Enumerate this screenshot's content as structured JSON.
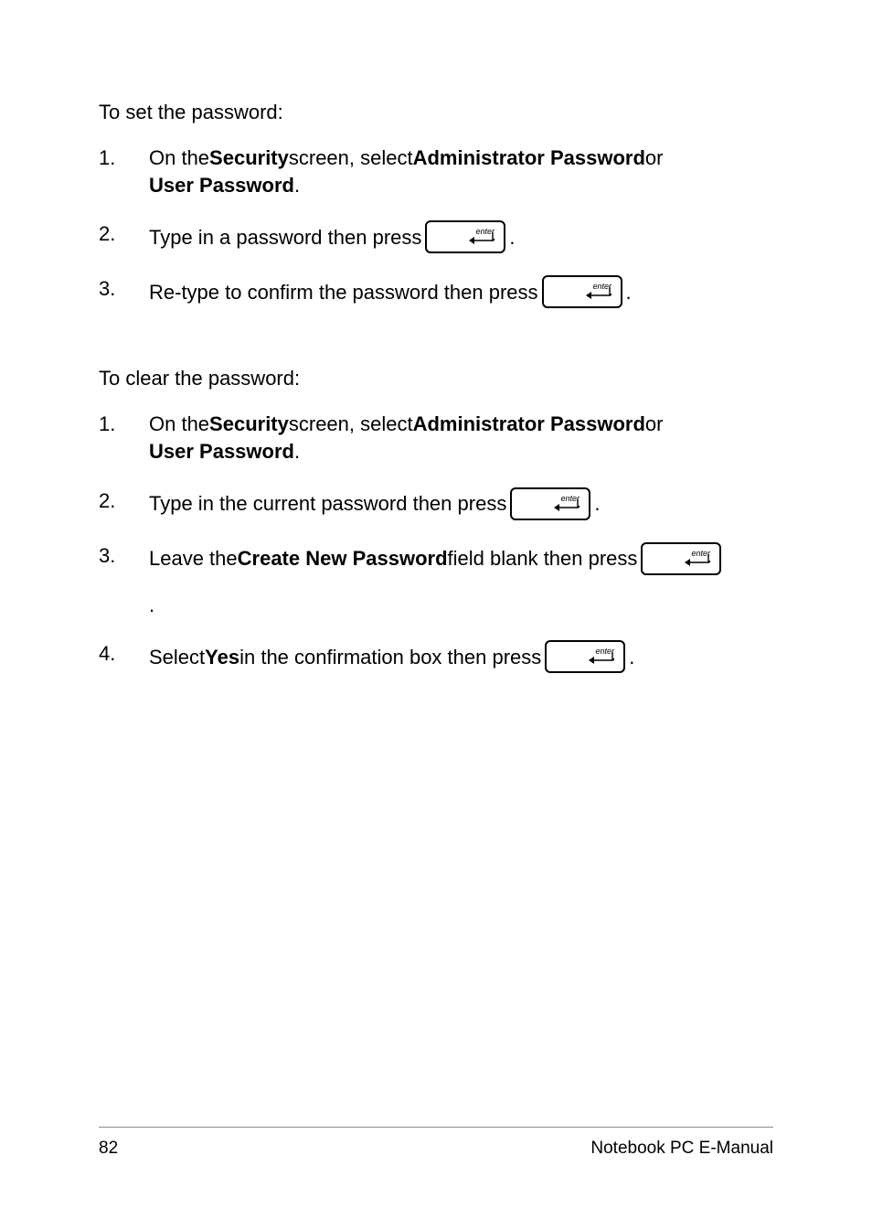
{
  "set": {
    "intro": "To set the password:",
    "steps": [
      {
        "num": "1.",
        "parts": [
          {
            "t": "text",
            "v": "On the "
          },
          {
            "t": "bold",
            "v": "Security"
          },
          {
            "t": "text",
            "v": " screen, select "
          },
          {
            "t": "bold",
            "v": "Administrator Password"
          },
          {
            "t": "text",
            "v": " or "
          },
          {
            "t": "bold",
            "v": "User Password"
          },
          {
            "t": "text",
            "v": "."
          }
        ]
      },
      {
        "num": "2.",
        "parts": [
          {
            "t": "text",
            "v": "Type in a password then press "
          },
          {
            "t": "key"
          },
          {
            "t": "text",
            "v": "."
          }
        ]
      },
      {
        "num": "3.",
        "parts": [
          {
            "t": "text",
            "v": "Re-type to confirm the password then press "
          },
          {
            "t": "key"
          },
          {
            "t": "text",
            "v": "."
          }
        ]
      }
    ]
  },
  "clear": {
    "intro": "To clear the password:",
    "steps": [
      {
        "num": "1.",
        "parts": [
          {
            "t": "text",
            "v": "On the "
          },
          {
            "t": "bold",
            "v": "Security"
          },
          {
            "t": "text",
            "v": " screen, select "
          },
          {
            "t": "bold",
            "v": "Administrator Password"
          },
          {
            "t": "text",
            "v": " or "
          },
          {
            "t": "bold",
            "v": "User Password"
          },
          {
            "t": "text",
            "v": "."
          }
        ]
      },
      {
        "num": "2.",
        "parts": [
          {
            "t": "text",
            "v": "Type in the current password then press "
          },
          {
            "t": "key"
          },
          {
            "t": "text",
            "v": "."
          }
        ]
      },
      {
        "num": "3.",
        "parts": [
          {
            "t": "text",
            "v": "Leave the "
          },
          {
            "t": "bold",
            "v": "Create New Password"
          },
          {
            "t": "text",
            "v": " field blank then press "
          },
          {
            "t": "key"
          }
        ],
        "dangling": "."
      },
      {
        "num": "4.",
        "parts": [
          {
            "t": "text",
            "v": "Select "
          },
          {
            "t": "bold",
            "v": "Yes"
          },
          {
            "t": "text",
            "v": " in the confirmation box then press "
          },
          {
            "t": "key"
          },
          {
            "t": "text",
            "v": "."
          }
        ]
      }
    ]
  },
  "footer": {
    "page": "82",
    "title": "Notebook PC E-Manual"
  },
  "key_label": "enter"
}
